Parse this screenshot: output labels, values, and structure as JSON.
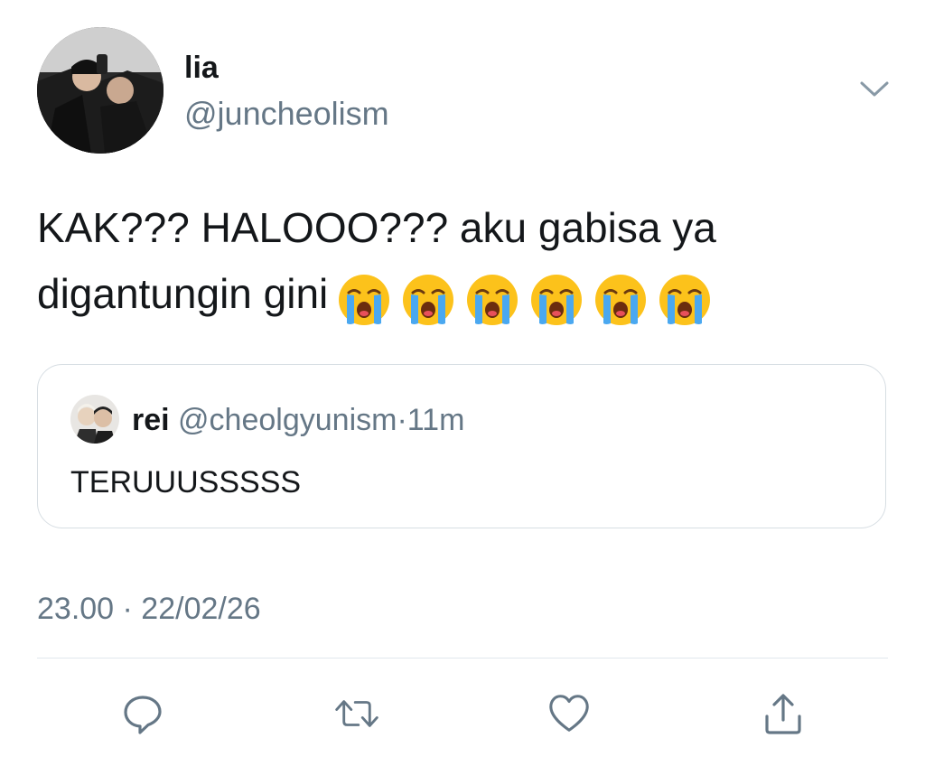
{
  "tweet": {
    "author": {
      "display_name": "lia",
      "handle": "@juncheolism"
    },
    "text_line1": "KAK??? HALOOO??? aku gabisa ya",
    "text_line2": "digantungin gini",
    "emojis": [
      "loudly-crying-face",
      "loudly-crying-face",
      "loudly-crying-face",
      "loudly-crying-face",
      "loudly-crying-face",
      "loudly-crying-face"
    ],
    "quoted": {
      "display_name": "rei",
      "handle": "@cheolgyunism",
      "separator": "·",
      "time": "11m",
      "text": "TERUUUSSSSS"
    },
    "timestamp": "23.00 · 22/02/26"
  },
  "actions": {
    "reply_icon": "reply-icon",
    "retweet_icon": "retweet-icon",
    "like_icon": "heart-icon",
    "share_icon": "share-icon"
  },
  "colors": {
    "text_primary": "#14171a",
    "text_secondary": "#657786",
    "border": "#d7dee3",
    "icon": "#657786"
  }
}
